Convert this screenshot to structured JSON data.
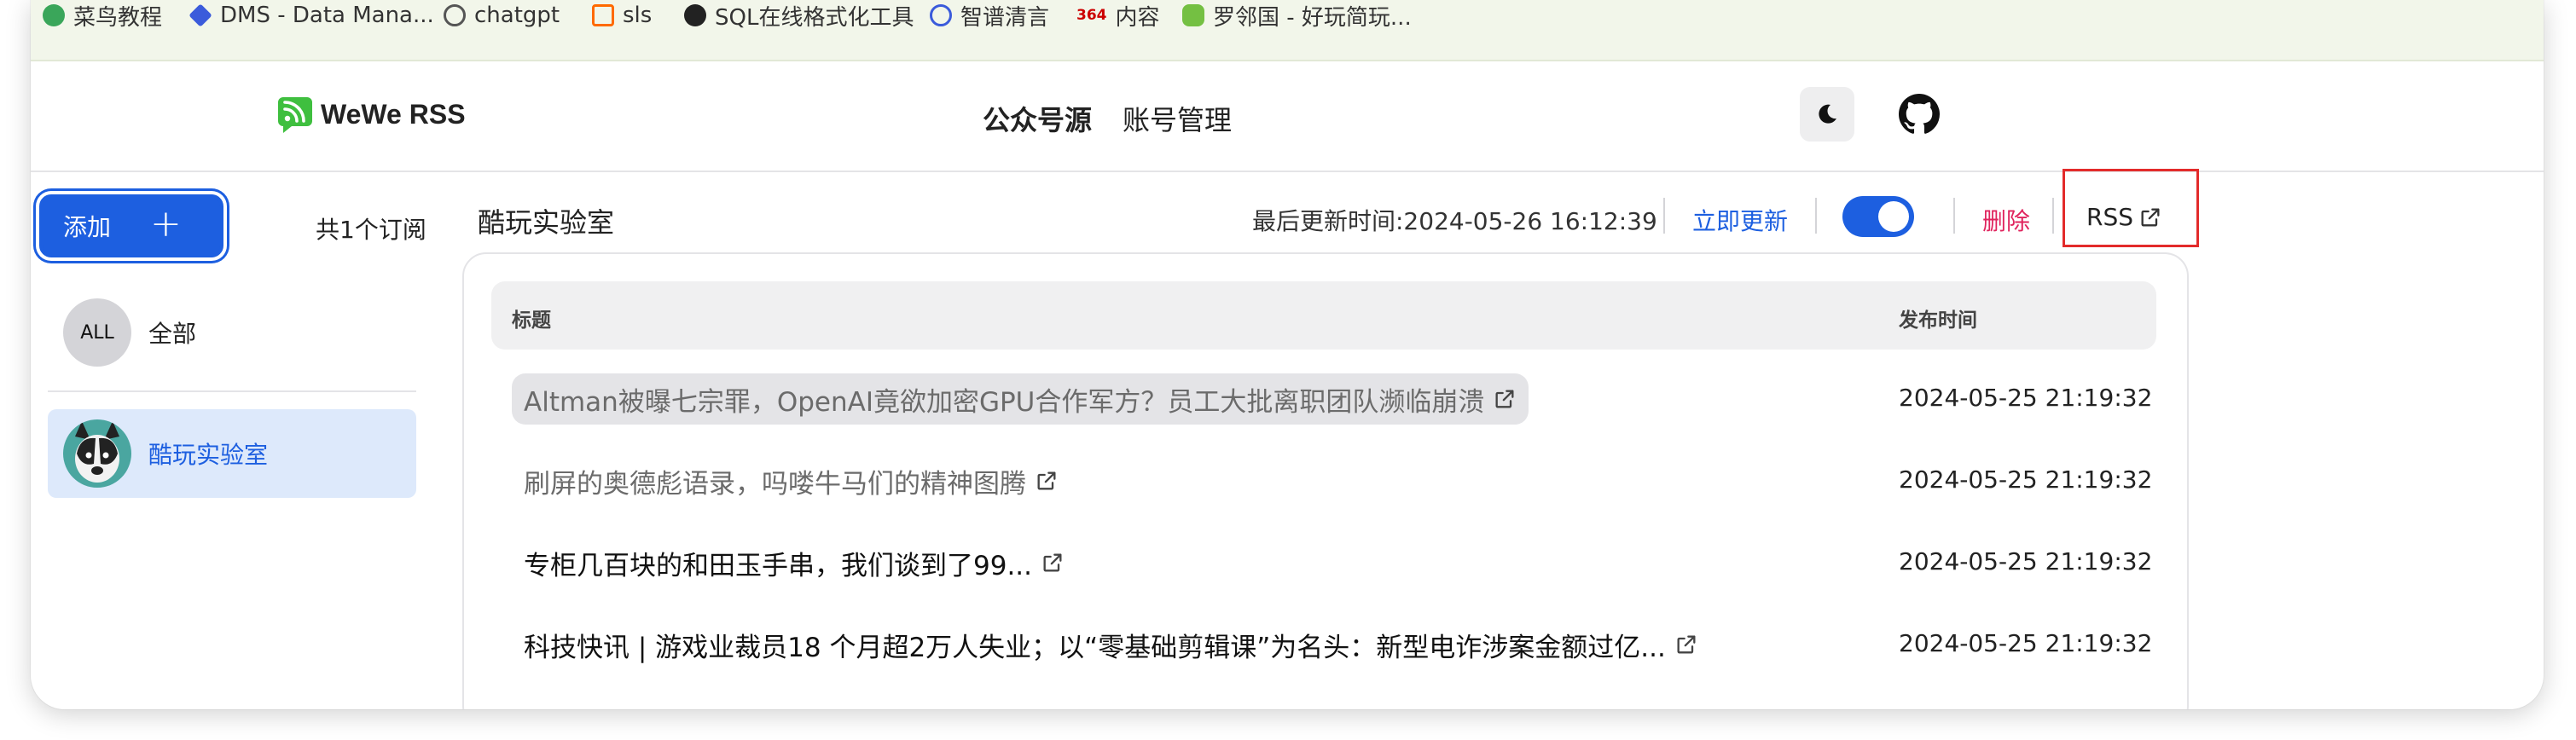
{
  "bookmarks": [
    {
      "label": "菜鸟教程",
      "color": "#3aa65a"
    },
    {
      "label": "DMS - Data Mana...",
      "color": "#3b5bdb"
    },
    {
      "label": "chatgpt",
      "color": "#555555"
    },
    {
      "label": "sls",
      "color": "#ff6a00"
    },
    {
      "label": "SQL在线格式化工具",
      "color": "#222222"
    },
    {
      "label": "智谱清言",
      "color": "#3b5bdb"
    },
    {
      "label": "内容",
      "color": "#e03131",
      "badge": "364"
    },
    {
      "label": "罗邻国 - 好玩简玩...",
      "color": "#74c042"
    }
  ],
  "header": {
    "app_name": "WeWe RSS",
    "nav": [
      "公众号源",
      "账号管理"
    ],
    "theme_icon": "moon-icon",
    "github_icon": "github-icon"
  },
  "sidebar": {
    "add_label": "添加",
    "add_icon": "plus-icon",
    "subscription_count": "共1个订阅",
    "items": [
      {
        "avatar": "ALL",
        "label": "全部"
      },
      {
        "label": "酷玩实验室",
        "selected": true
      }
    ]
  },
  "main": {
    "feed_title": "酷玩实验室",
    "last_updated": "最后更新时间:2024-05-26 16:12:39",
    "update_now": "立即更新",
    "enabled": true,
    "delete": "删除",
    "rss": "RSS",
    "table": {
      "headers": [
        "标题",
        "发布时间"
      ],
      "rows": [
        {
          "title": "Altman被曝七宗罪，OpenAI竟欲加密GPU合作军方？员工大批离职团队濒临崩溃",
          "time": "2024-05-25 21:19:32",
          "visited": true,
          "hovered": true
        },
        {
          "title": "刷屏的奥德彪语录，吗喽牛马们的精神图腾",
          "time": "2024-05-25 21:19:32",
          "visited": true
        },
        {
          "title": "专柜几百块的和田玉手串，我们谈到了99...",
          "time": "2024-05-25 21:19:32",
          "visited": false
        },
        {
          "title": "科技快讯 | 游戏业裁员18 个月超2万人失业；以“零基础剪辑课”为名头：新型电诈涉案金额过亿...",
          "time": "2024-05-25 21:19:32",
          "visited": false
        }
      ]
    }
  },
  "colors": {
    "primary": "#1d5fe0",
    "danger": "#e0245e",
    "highlight_box": "#e32b2b",
    "visited_text": "#6b6b6b"
  }
}
